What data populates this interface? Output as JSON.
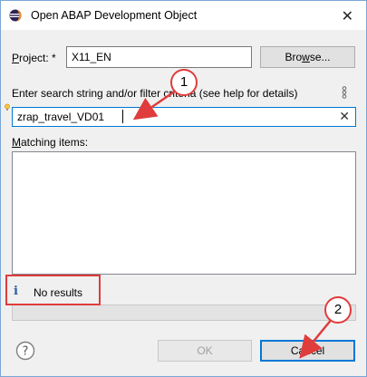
{
  "window": {
    "title": "Open ABAP Development Object"
  },
  "project": {
    "label": "Project: *",
    "value": "X11_EN",
    "browse_label": "Browse..."
  },
  "search": {
    "label": "Enter search string and/or filter criteria (see help for details)",
    "value": "zrap_travel_VD01"
  },
  "matching": {
    "label": "Matching items:"
  },
  "status": {
    "text": "No results"
  },
  "buttons": {
    "ok_label": "OK",
    "cancel_label": "Cancel"
  },
  "callouts": {
    "one": "1",
    "two": "2"
  },
  "colors": {
    "annotation": "#e03c3c",
    "focus": "#0078d7"
  }
}
